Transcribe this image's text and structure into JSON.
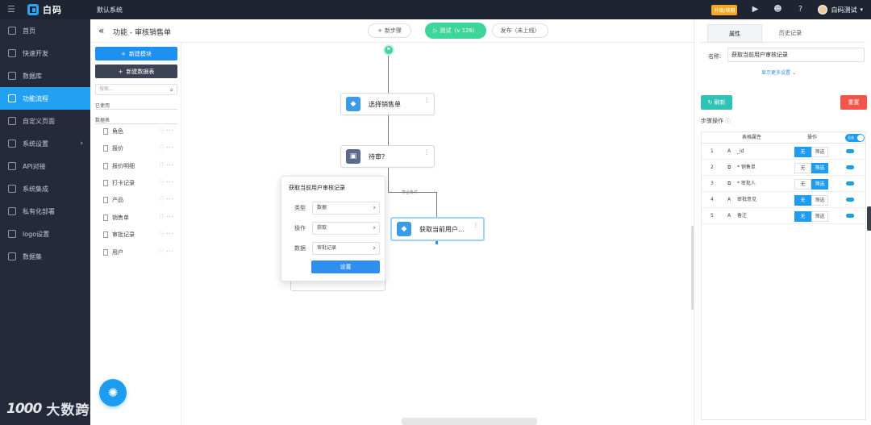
{
  "topbar": {
    "brand": "白码",
    "system_name": "默认系统",
    "upgrade_label": "升级/续期",
    "user_name": "白码测试"
  },
  "sidebar": {
    "items": [
      {
        "label": "首页",
        "icon": "home-icon"
      },
      {
        "label": "快速开发",
        "icon": "cube-icon"
      },
      {
        "label": "数据库",
        "icon": "database-icon"
      },
      {
        "label": "功能流程",
        "icon": "flow-icon",
        "active": true
      },
      {
        "label": "自定义页面",
        "icon": "page-icon"
      },
      {
        "label": "系统设置",
        "icon": "monitor-icon",
        "has_arrow": true
      },
      {
        "label": "API对接",
        "icon": "api-icon"
      },
      {
        "label": "系统集成",
        "icon": "layers-icon"
      },
      {
        "label": "私有化部署",
        "icon": "server-icon"
      },
      {
        "label": "logo设置",
        "icon": "image-icon"
      },
      {
        "label": "数据集",
        "icon": "dataset-icon"
      }
    ]
  },
  "watermark": {
    "logo": "1000",
    "text": "大数跨境"
  },
  "header": {
    "title": "功能 - 审核销售单",
    "new_step": "新步骤",
    "test": "测试（v 126）",
    "publish": "发布（未上线）"
  },
  "leftpanel": {
    "new_module": "新建模块",
    "new_table": "新建数据表",
    "search_placeholder": "搜索...",
    "used_label": "已使用",
    "tables_label": "数据表",
    "tables": [
      "角色",
      "报价",
      "报价明细",
      "打卡记录",
      "产品",
      "销售单",
      "审批记录",
      "用户"
    ]
  },
  "canvas": {
    "nodes": {
      "select": "选择销售单",
      "pending": "待审?",
      "get_user": "获取当前用户..."
    },
    "condition_label": "符合条件",
    "popup": {
      "title": "获取当前用户审核记录",
      "type_label": "类型",
      "type_value": "数据",
      "op_label": "操作",
      "op_value": "获取",
      "data_label": "数据",
      "data_value": "审批记录",
      "button": "设置"
    }
  },
  "rightpanel": {
    "tab_props": "属性",
    "tab_history": "历史记录",
    "name_label": "名称:",
    "name_value": "获取当前用户审核记录",
    "more_settings": "显示更多设置",
    "refresh": "刷新",
    "reset": "重置",
    "step_ops": "步骤操作",
    "col_attr": "表格属性",
    "col_op": "操作",
    "head_toggle": "全选",
    "op_none": "无",
    "op_filter": "筛选",
    "rows": [
      {
        "idx": "1",
        "name": "_id",
        "on": "none"
      },
      {
        "idx": "2",
        "name": "* 销售单",
        "on": "filter"
      },
      {
        "idx": "3",
        "name": "* 审批人",
        "on": "filter"
      },
      {
        "idx": "4",
        "name": "审批意见",
        "on": "none"
      },
      {
        "idx": "5",
        "name": "备注",
        "on": "none"
      }
    ]
  },
  "colors": {
    "accent": "#22a0f2",
    "test_green": "#3dd59a",
    "reset_red": "#f0574a",
    "refresh_teal": "#2fc3b5"
  }
}
